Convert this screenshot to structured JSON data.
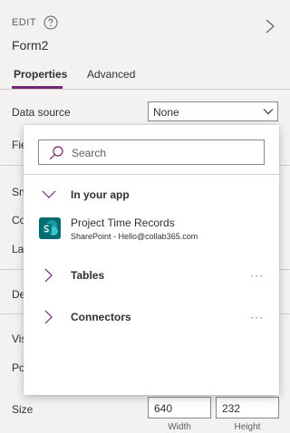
{
  "header": {
    "edit_label": "EDIT",
    "form_name": "Form2"
  },
  "tabs": [
    {
      "label": "Properties",
      "active": true
    },
    {
      "label": "Advanced",
      "active": false
    }
  ],
  "properties": {
    "data_source_label": "Data source",
    "data_source_value": "None",
    "fields_label": "Fie",
    "snap_label": "Sn",
    "columns_label": "Co",
    "layout_label": "La",
    "default_mode_label": "De",
    "visible_label": "Vis",
    "position_label": "Po",
    "size_label": "Size",
    "size_width": "640",
    "size_height": "232",
    "width_caption": "Width",
    "height_caption": "Height"
  },
  "dropdown": {
    "search_placeholder": "Search",
    "groups": {
      "in_your_app": "In your app",
      "tables": "Tables",
      "connectors": "Connectors"
    },
    "source_item": {
      "title": "Project Time Records",
      "subtitle": "SharePoint - Hello@collab365.com"
    },
    "more_glyph": "···"
  },
  "colors": {
    "accent": "#742774",
    "sharepoint": "#036c70",
    "panel_bg": "#f3f2f1"
  },
  "icons": {
    "help": "question-circle-icon",
    "expand_right": "chevron-right-icon",
    "dropdown": "chevron-down-icon",
    "search": "search-icon",
    "more": "more-horizontal-icon"
  }
}
